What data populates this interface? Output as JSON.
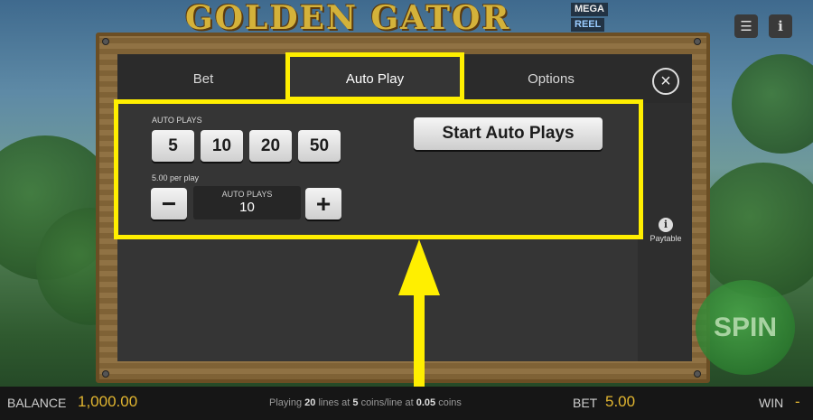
{
  "game": {
    "logo_text": "GOLDEN GATOR",
    "logo_badge_top": "MEGA",
    "logo_badge_bottom": "REEL"
  },
  "header": {
    "menu_icon": "hamburger-icon",
    "info_icon": "info-icon"
  },
  "modal": {
    "tabs": [
      {
        "label": "Bet",
        "active": false
      },
      {
        "label": "Auto Play",
        "active": true
      },
      {
        "label": "Options",
        "active": false
      }
    ],
    "close_icon": "close-icon",
    "auto_plays_label": "AUTO PLAYS",
    "presets": [
      "5",
      "10",
      "20",
      "50"
    ],
    "per_play_text": "5.00 per play",
    "stepper": {
      "minus_symbol": "−",
      "plus_symbol": "+",
      "label": "AUTO PLAYS",
      "value": "10"
    },
    "start_button_label": "Start Auto Plays",
    "paytable": {
      "icon_glyph": "i",
      "label": "Paytable"
    }
  },
  "spin_button_label": "SPIN",
  "footer": {
    "balance_label": "BALANCE",
    "balance_value": "1,000.00",
    "status_prefix": "Playing",
    "status_lines": "20",
    "status_mid": "lines at",
    "status_coins": "5",
    "status_mid2": "coins/line at",
    "status_coin_value": "0.05",
    "status_suffix": "coins",
    "bet_label": "BET",
    "bet_value": "5.00",
    "win_label": "WIN",
    "win_value": "-"
  },
  "colors": {
    "highlight": "#ffef00",
    "balance_value": "#e2b630"
  }
}
